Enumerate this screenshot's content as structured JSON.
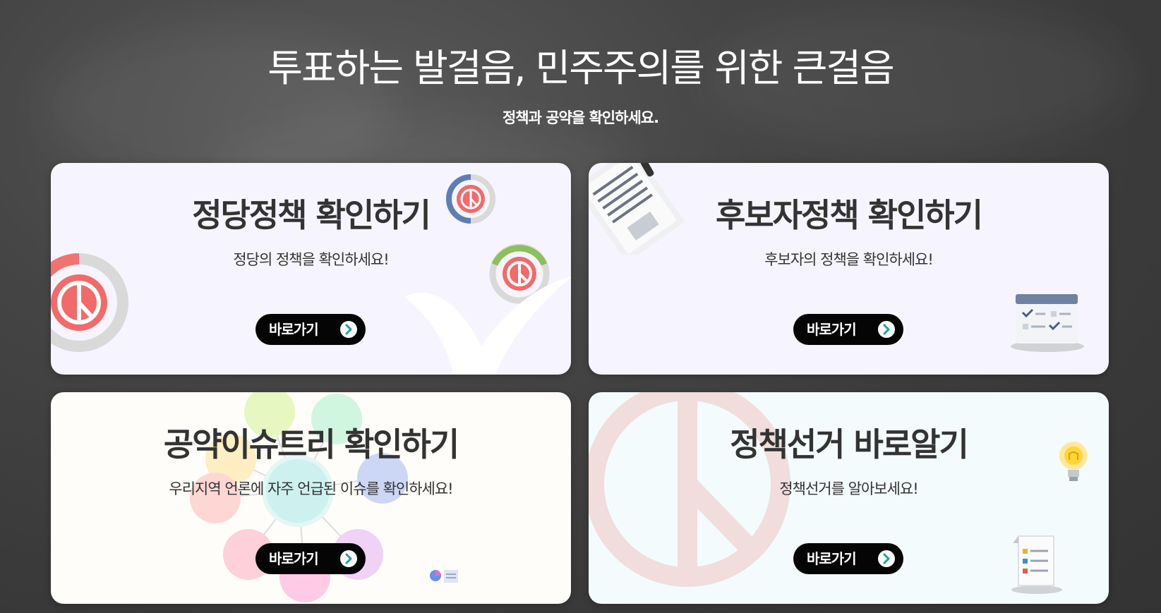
{
  "hero": {
    "title": "투표하는 발걸음, 민주주의를 위한 큰걸음",
    "subtitle": "정책과 공약을 확인하세요."
  },
  "cards": [
    {
      "title": "정당정책 확인하기",
      "desc": "정당의 정책을 확인하세요!",
      "button": "바로가기",
      "background": "#f6f4fe"
    },
    {
      "title": "후보자정책 확인하기",
      "desc": "후보자의 정책을 확인하세요!",
      "button": "바로가기",
      "background": "#f6f4fe"
    },
    {
      "title": "공약이슈트리 확인하기",
      "desc": "우리지역 언론에 자주 언급된 이슈를 확인하세요!",
      "button": "바로가기",
      "background": "#fefdf9"
    },
    {
      "title": "정책선거 바로알기",
      "desc": "정책선거를 알아보세요!",
      "button": "바로가기",
      "background": "#f4fbfd"
    }
  ],
  "colors": {
    "button_bg": "#050505",
    "arrow_accent": "#1aa39b",
    "title_text": "#333333"
  },
  "icons": {
    "button_arrow": "chevron-right-circle-icon"
  }
}
